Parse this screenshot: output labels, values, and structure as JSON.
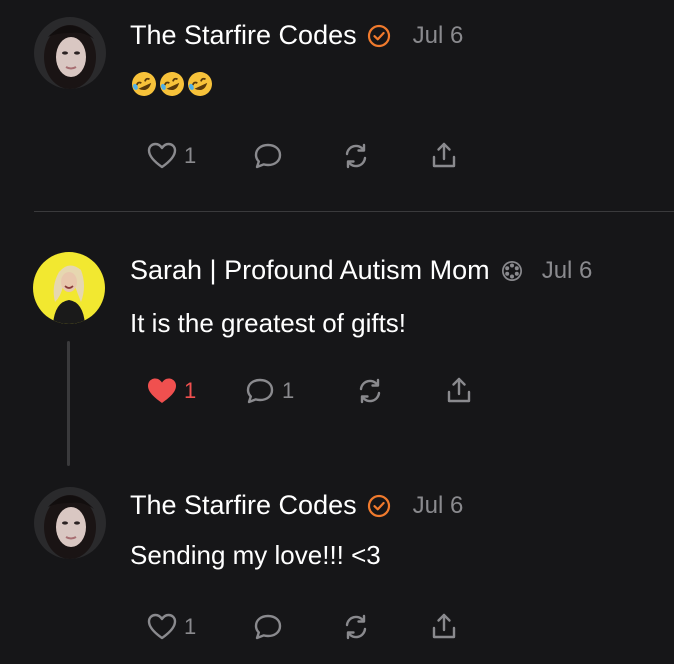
{
  "colors": {
    "background": "#161618",
    "text_primary": "#ffffff",
    "text_secondary": "#8a8a8e",
    "accent_verified": "#f07a2d",
    "like_red": "#f0504f",
    "divider": "#3a3a3c"
  },
  "posts": [
    {
      "author": "The Starfire Codes",
      "badge": "orange-check-badge-icon",
      "date": "Jul 6",
      "text": "🤣🤣🤣",
      "like_count": "1",
      "comment_count": "",
      "liked": false
    },
    {
      "author": "Sarah | Profound Autism Mom",
      "badge": "gear-badge-icon",
      "date": "Jul 6",
      "text": "It is the greatest of gifts!",
      "like_count": "1",
      "comment_count": "1",
      "liked": true
    },
    {
      "author": "The Starfire Codes",
      "badge": "orange-check-badge-icon",
      "date": "Jul 6",
      "text": "Sending my love!!! <3",
      "like_count": "1",
      "comment_count": "",
      "liked": false
    }
  ]
}
